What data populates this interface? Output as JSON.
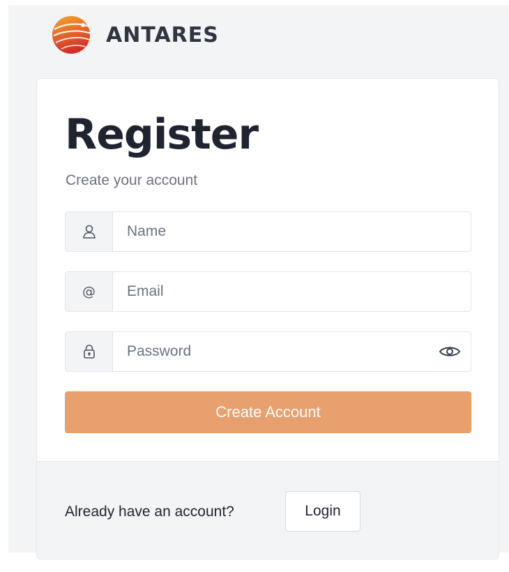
{
  "brand": {
    "name": "ANTARES"
  },
  "register": {
    "title": "Register",
    "subtitle": "Create your account"
  },
  "fields": {
    "name": {
      "placeholder": "Name",
      "icon": "user-icon"
    },
    "email": {
      "placeholder": "Email",
      "icon": "at-sign-icon",
      "glyph": "@"
    },
    "password": {
      "placeholder": "Password",
      "icon": "lock-icon",
      "toggle_icon": "eye-icon"
    }
  },
  "actions": {
    "create_account_label": "Create Account"
  },
  "footer": {
    "prompt": "Already have an account?",
    "login_label": "Login"
  },
  "colors": {
    "primary_button": "#e8a06e",
    "page_background": "#f3f4f6",
    "logo_orange": "#f39a2a",
    "logo_red": "#d9332a"
  }
}
